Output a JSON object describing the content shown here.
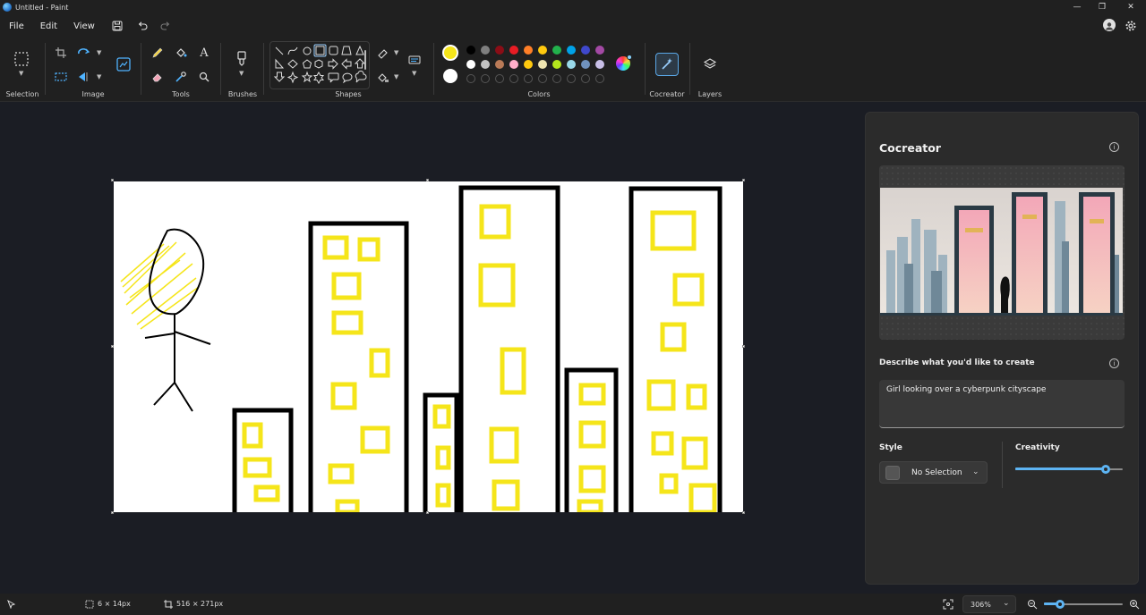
{
  "window": {
    "title": "Untitled - Paint",
    "minimize": "—",
    "maximize": "❐",
    "close": "✕"
  },
  "menu": {
    "file": "File",
    "edit": "Edit",
    "view": "View"
  },
  "ribbon": {
    "selection_label": "Selection",
    "image_label": "Image",
    "tools_label": "Tools",
    "brushes_label": "Brushes",
    "shapes_label": "Shapes",
    "colors_label": "Colors",
    "cocreator_label": "Cocreator",
    "layers_label": "Layers",
    "text_tool_glyph": "A",
    "colors": {
      "primary": "#f5e51a",
      "secondary": "#ffffff",
      "row1": [
        "#000000",
        "#7f7f7f",
        "#8b0d16",
        "#e81c24",
        "#ff7f27",
        "#ffc90e",
        "#22b14c",
        "#00a2e8",
        "#3f48cc",
        "#a349a4"
      ],
      "row2": [
        "#ffffff",
        "#c3c3c3",
        "#b97a57",
        "#ffaec9",
        "#ffc90e",
        "#efe4b0",
        "#b5e61d",
        "#99d9ea",
        "#7092be",
        "#c8bfe7"
      ]
    }
  },
  "cocreator": {
    "title": "Cocreator",
    "prompt_label": "Describe what you'd like to create",
    "prompt_value": "Girl looking over a cyberpunk cityscape",
    "style_label": "Style",
    "style_value": "No Selection",
    "creativity_label": "Creativity",
    "creativity_value": 0.84
  },
  "status": {
    "cursor_pos": "6 × 14px",
    "canvas_size": "516 × 271px",
    "zoom": "306%",
    "zoom_slider_value": 0.2
  }
}
